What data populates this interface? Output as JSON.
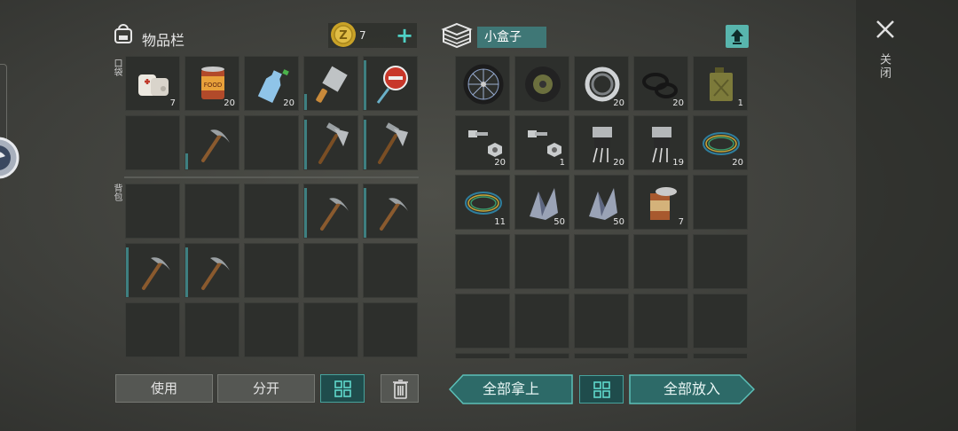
{
  "inventory": {
    "title": "物品栏",
    "coins": "7",
    "section_pocket": "口袋",
    "section_backpack": "背包",
    "pocket_slots": [
      {
        "item": "bandage-icon",
        "qty": "7"
      },
      {
        "item": "canned-food-icon",
        "qty": "20"
      },
      {
        "item": "water-bottle-icon",
        "qty": "20"
      },
      {
        "item": "cleaver-icon",
        "qty": ""
      },
      {
        "item": "stop-sign-icon",
        "qty": ""
      },
      {
        "item": "empty",
        "qty": ""
      },
      {
        "item": "pickaxe-icon",
        "qty": ""
      },
      {
        "item": "empty",
        "qty": ""
      },
      {
        "item": "hammer-axe-icon",
        "qty": ""
      },
      {
        "item": "hammer-axe-icon",
        "qty": ""
      }
    ],
    "backpack_slots": [
      {
        "item": "empty",
        "qty": ""
      },
      {
        "item": "empty",
        "qty": ""
      },
      {
        "item": "empty",
        "qty": ""
      },
      {
        "item": "pickaxe-icon",
        "qty": ""
      },
      {
        "item": "pickaxe-icon",
        "qty": ""
      },
      {
        "item": "pickaxe-icon",
        "qty": ""
      },
      {
        "item": "pickaxe-icon",
        "qty": ""
      },
      {
        "item": "empty",
        "qty": ""
      },
      {
        "item": "empty",
        "qty": ""
      },
      {
        "item": "empty",
        "qty": ""
      },
      {
        "item": "empty",
        "qty": ""
      },
      {
        "item": "empty",
        "qty": ""
      },
      {
        "item": "empty",
        "qty": ""
      },
      {
        "item": "empty",
        "qty": ""
      },
      {
        "item": "empty",
        "qty": ""
      }
    ]
  },
  "container": {
    "name": "小盒子",
    "slots": [
      {
        "item": "bicycle-wheel-icon",
        "qty": ""
      },
      {
        "item": "tire-icon",
        "qty": ""
      },
      {
        "item": "bearing-icon",
        "qty": "20"
      },
      {
        "item": "rubber-ring-icon",
        "qty": "20"
      },
      {
        "item": "jerrycan-icon",
        "qty": "1"
      },
      {
        "item": "bolt-nut-icon",
        "qty": "20"
      },
      {
        "item": "bolt-nut-icon",
        "qty": "1"
      },
      {
        "item": "transistor-icon",
        "qty": "20"
      },
      {
        "item": "transistor-icon",
        "qty": "19"
      },
      {
        "item": "wire-coil-icon",
        "qty": "20"
      },
      {
        "item": "wire-coil-icon",
        "qty": "11"
      },
      {
        "item": "scrap-metal-icon",
        "qty": "50"
      },
      {
        "item": "scrap-metal-icon",
        "qty": "50"
      },
      {
        "item": "open-can-icon",
        "qty": "7"
      }
    ]
  },
  "buttons": {
    "use": "使用",
    "split": "分开",
    "take_all": "全部拿上",
    "put_all": "全部放入"
  },
  "close_label": "关闭",
  "colors": {
    "accent": "#4fd1c5",
    "teal_dark": "#1f4c4c",
    "slot_bg": "#2d2f2c"
  }
}
